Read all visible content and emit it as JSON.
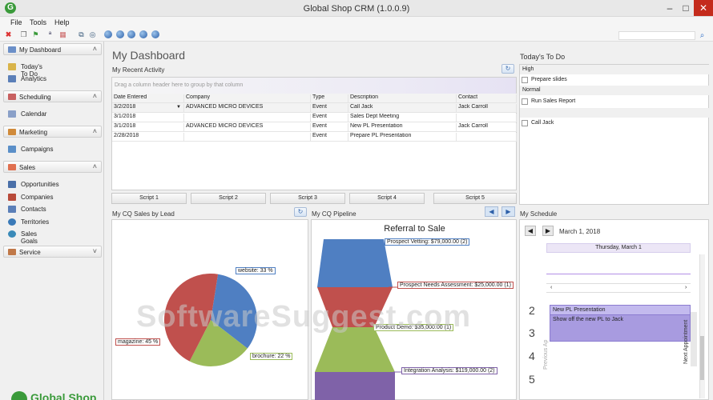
{
  "window": {
    "title": "Global Shop CRM (1.0.0.9)",
    "app_icon": "G",
    "minimize_icon": "–",
    "maximize_icon": "□",
    "close_icon": "✕"
  },
  "menu": [
    "File",
    "Tools",
    "Help"
  ],
  "toolbar": {
    "icons": [
      "delete-icon",
      "copy-icon",
      "flag-icon",
      "spellcheck-icon",
      "calendar-icon",
      "link-icon",
      "view-icon"
    ],
    "nav_balls": 5
  },
  "sidebar": {
    "sections": [
      {
        "label": "My Dashboard",
        "items": [
          "Today's To Do",
          "Analytics"
        ]
      },
      {
        "label": "Scheduling",
        "items": [
          "Calendar"
        ]
      },
      {
        "label": "Marketing",
        "items": [
          "Campaigns"
        ]
      },
      {
        "label": "Sales",
        "items": [
          "Opportunities",
          "Companies",
          "Contacts",
          "Territories",
          "Sales Goals"
        ]
      },
      {
        "label": "Service",
        "items": []
      }
    ],
    "logo": "Global Shop"
  },
  "dashboard": {
    "title": "My Dashboard"
  },
  "activity": {
    "title": "My Recent Activity",
    "group_hint": "Drag a column header here to group by that column",
    "columns": [
      "Date Entered",
      "Company",
      "Type",
      "Description",
      "Contact"
    ],
    "rows": [
      [
        "3/2/2018",
        "ADVANCED MICRO DEVICES",
        "Event",
        "Call Jack",
        "Jack Carroll"
      ],
      [
        "3/1/2018",
        "",
        "Event",
        "Sales Dept Meeting",
        ""
      ],
      [
        "3/1/2018",
        "ADVANCED MICRO DEVICES",
        "Event",
        "New PL Presentation",
        "Jack Carroll"
      ],
      [
        "2/28/2018",
        "",
        "Event",
        "Prepare PL Presentation",
        ""
      ]
    ],
    "scripts": [
      "Script 1",
      "Script 2",
      "Script 3",
      "Script 4",
      "Script 5"
    ]
  },
  "todo": {
    "title": "Today's To Do",
    "groups": [
      {
        "label": "High",
        "items": [
          "Prepare slides"
        ]
      },
      {
        "label": "Normal",
        "items": [
          "Run Sales Report"
        ]
      },
      {
        "label": "",
        "items": [
          "Call Jack"
        ]
      }
    ]
  },
  "cq_sales": {
    "title": "My CQ Sales by Lead",
    "slices": [
      {
        "label": "website: 33 %",
        "value": 33,
        "color": "#4f7fc2"
      },
      {
        "label": "brochure: 22 %",
        "value": 22,
        "color": "#9bbb59"
      },
      {
        "label": "magazine: 45 %",
        "value": 45,
        "color": "#c0504d"
      }
    ]
  },
  "pipeline": {
    "title": "My CQ Pipeline",
    "chart_title": "Referral to Sale",
    "stages": [
      {
        "label": "Prospect Vetting: $79,000.00 (2)",
        "color": "#4f7fc2"
      },
      {
        "label": "Prospect Needs Assessment: $25,000.00 (1)",
        "color": "#c0504d"
      },
      {
        "label": "Product Demo: $35,000.00 (1)",
        "color": "#9bbb59"
      },
      {
        "label": "Integration Analysis: $119,000.00 (2)",
        "color": "#7f62a8"
      }
    ]
  },
  "schedule": {
    "title": "My Schedule",
    "date": "March 1, 2018",
    "day_header": "Thursday, March 1",
    "hours": [
      "2",
      "3",
      "4",
      "5"
    ],
    "appointment_title": "New PL Presentation",
    "appointment_desc": "Show off the new PL to Jack",
    "prev_label": "Previous Ap",
    "next_label": "Next Appointment"
  },
  "watermark": "SoftwareSuggest.com"
}
